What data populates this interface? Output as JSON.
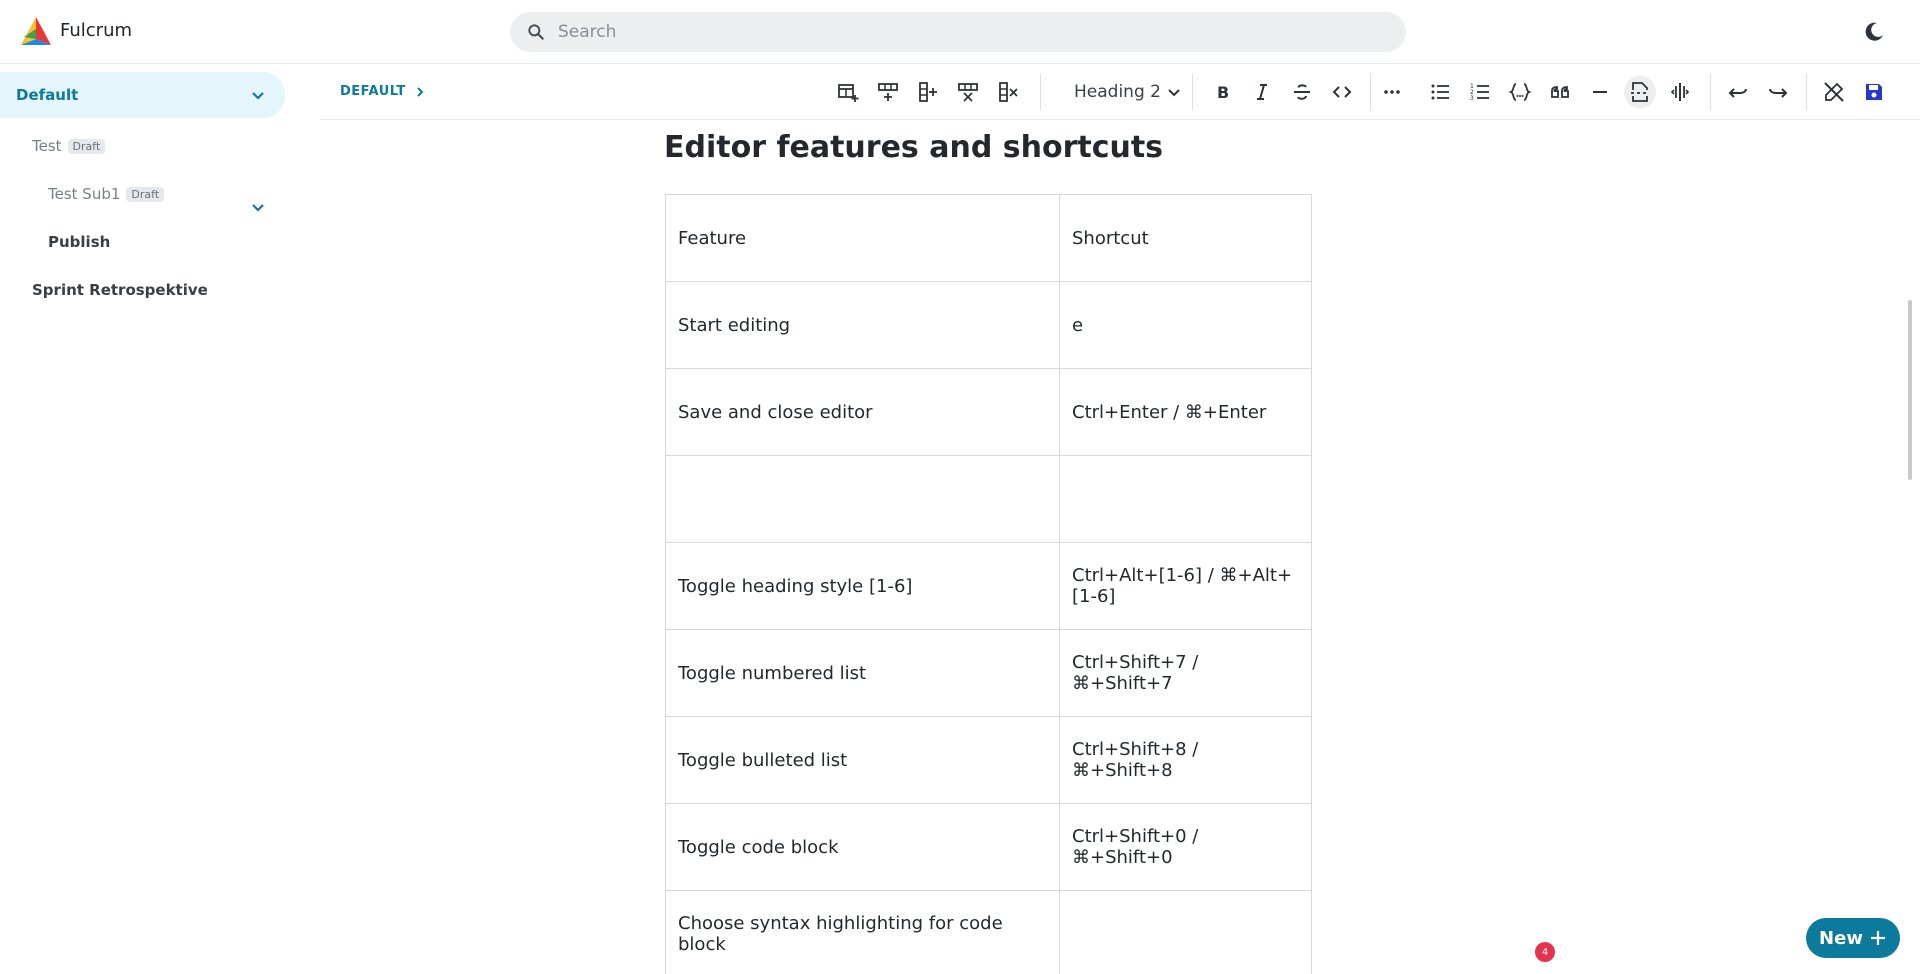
{
  "app": {
    "title": "Fulcrum"
  },
  "search": {
    "placeholder": "Search"
  },
  "sidebar": {
    "items": [
      {
        "label": "Default"
      },
      {
        "label": "Test",
        "badge": "Draft"
      },
      {
        "label": "Test Sub1",
        "badge": "Draft"
      },
      {
        "label": "Publish"
      },
      {
        "label": "Sprint Retrospektive"
      }
    ]
  },
  "breadcrumb": {
    "label": "DEFAULT"
  },
  "toolbar": {
    "heading_value": "Heading 2",
    "icons": [
      "table-insert-icon",
      "row-insert-icon",
      "column-insert-icon",
      "row-delete-icon",
      "column-delete-icon",
      "bold-icon",
      "italic-icon",
      "strikethrough-icon",
      "code-inline-icon",
      "more-icon",
      "bullet-list-icon",
      "numbered-list-icon",
      "code-block-icon",
      "quote-icon",
      "horizontal-rule-icon",
      "page-break-icon",
      "split-icon",
      "undo-icon",
      "redo-icon",
      "exit-edit-icon",
      "save-icon"
    ]
  },
  "document": {
    "title": "Editor features and shortcuts",
    "table": {
      "rows": [
        [
          "Feature",
          "Shortcut"
        ],
        [
          "Start editing",
          "e"
        ],
        [
          "Save and close editor",
          "Ctrl+Enter / ⌘+Enter"
        ],
        [
          "",
          ""
        ],
        [
          "Toggle heading style [1-6]",
          "Ctrl+Alt+[1-6] / ⌘+Alt+[1-6]"
        ],
        [
          "Toggle numbered list",
          "Ctrl+Shift+7 / ⌘+Shift+7"
        ],
        [
          "Toggle bulleted list",
          "Ctrl+Shift+8 / ⌘+Shift+8"
        ],
        [
          "Toggle code block",
          "Ctrl+Shift+0 / ⌘+Shift+0"
        ],
        [
          "Choose syntax highlighting for code block",
          ""
        ]
      ]
    }
  },
  "notification": {
    "count": "4"
  },
  "new_button": {
    "label": "New"
  },
  "colors": {
    "accent": "#0c7a9c",
    "sidebar_active_bg": "#e4f5fb",
    "notification": "#e5334f"
  }
}
